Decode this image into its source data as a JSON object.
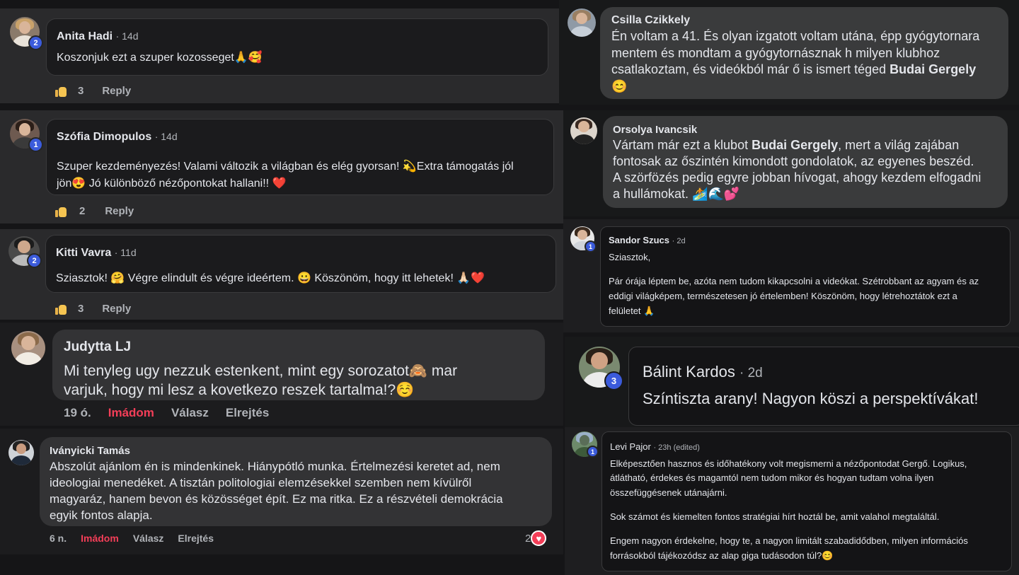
{
  "comments": {
    "anita": {
      "name": "Anita Hadi",
      "time": "14d",
      "text": "Koszonjuk ezt a szuper kozosseget🙏🥰",
      "likes": "3",
      "reply": "Reply",
      "badge": "2"
    },
    "szofia": {
      "name": "Szófia Dimopulos",
      "time": "14d",
      "line1": "Szuper kezdeményezés! Valami változik a világban és elég gyorsan! 💫Extra támogatás jól",
      "line2": "jön😍 Jó különböző nézőpontokat hallani!! ❤️",
      "likes": "2",
      "reply": "Reply",
      "badge": "1"
    },
    "kitti": {
      "name": "Kitti Vavra",
      "time": "11d",
      "text": "Sziasztok! 🤗 Végre elindult és végre ideértem. 😀 Köszönöm, hogy itt lehetek! 🙏🏻❤️",
      "likes": "3",
      "reply": "Reply",
      "badge": "2"
    },
    "judytta": {
      "name": "Judytta LJ",
      "line1": "Mi tenyleg ugy nezzuk estenkent, mint egy sorozatot🙈 mar",
      "line2": "varjuk, hogy mi lesz a kovetkezo reszek tartalma!?☺️",
      "time": "19 ó.",
      "love": "Imádom",
      "reply": "Válasz",
      "hide": "Elrejtés"
    },
    "ivanyicki": {
      "name": "Iványicki Tamás",
      "line1": "Abszolút ajánlom én is mindenkinek. Hiánypótló munka. Értelmezési keretet ad, nem",
      "line2": "ideologiai menedéket. A tisztán politologiai elemzésekkel szemben nem kívülről",
      "line3": "magyaráz, hanem bevon és közösséget épít. Ez ma ritka. Ez a részvételi demokrácia",
      "line4": "egyik fontos alapja.",
      "time": "6 n.",
      "love": "Imádom",
      "reply": "Válasz",
      "hide": "Elrejtés",
      "reactions": "2"
    },
    "csilla": {
      "name": "Csilla Czikkely",
      "line1": "Én voltam a 41. És olyan izgatott voltam utána, épp gyógytornara",
      "line2": "mentem és mondtam a gyógytornásznak h milyen klubhoz",
      "line3a": "csatlakoztam, és videókból már ő is ismert téged ",
      "mention": "Budai Gergely",
      "line4": "😊"
    },
    "orsolya": {
      "name": "Orsolya Ivancsik",
      "line1a": "Vártam már ezt a klubot ",
      "mention": "Budai Gergely",
      "line1b": ", mert a világ zajában",
      "line2": "fontosak az őszintén kimondott gondolatok, az egyenes beszéd.",
      "line3": "A szörfözés pedig egyre jobban hívogat, ahogy kezdem elfogadni",
      "line4": "a hullámokat. 🏄🌊💕"
    },
    "sandor": {
      "name": "Sandor Szucs",
      "time": "2d",
      "badge": "1",
      "p1": "Sziasztok,",
      "p2a": "Pár órája léptem be, azóta nem tudom kikapcsolni a videókat. Szétrobbant az agyam és az",
      "p2b": "eddigi világképem, természetesen jó értelemben! Köszönöm, hogy létrehoztátok ezt a",
      "p2c": "felületet 🙏"
    },
    "balint": {
      "name": "Bálint Kardos",
      "time": "2d",
      "badge": "3",
      "text": "Színtiszta arany! Nagyon köszi a perspektívákat!"
    },
    "levi": {
      "name": "Levi Pajor",
      "time": "23h (edited)",
      "badge": "1",
      "p1a": "Elképesztően hasznos és időhatékony volt megismerni a nézőpontodat Gergő. Logikus,",
      "p1b": "átlátható, érdekes és magamtól nem tudom mikor és hogyan tudtam volna ilyen",
      "p1c": "összefüggésenek utánajárni.",
      "p2": "Sok számot és kiemelten fontos stratégiai hírt hoztál be, amit valahol megtaláltál.",
      "p3a": "Engem nagyon érdekelne, hogy te, a nagyon limitált szabadidődben, milyen információs",
      "p3b": "forrásokból tájékozódsz az alap giga tudásodon túl?😊"
    }
  },
  "colors": {
    "panel": "#242526",
    "bubble": "#1c1c1e",
    "bubble_alt": "#3a3b3c",
    "love": "#f33e58",
    "badge": "#3b5bdb"
  }
}
